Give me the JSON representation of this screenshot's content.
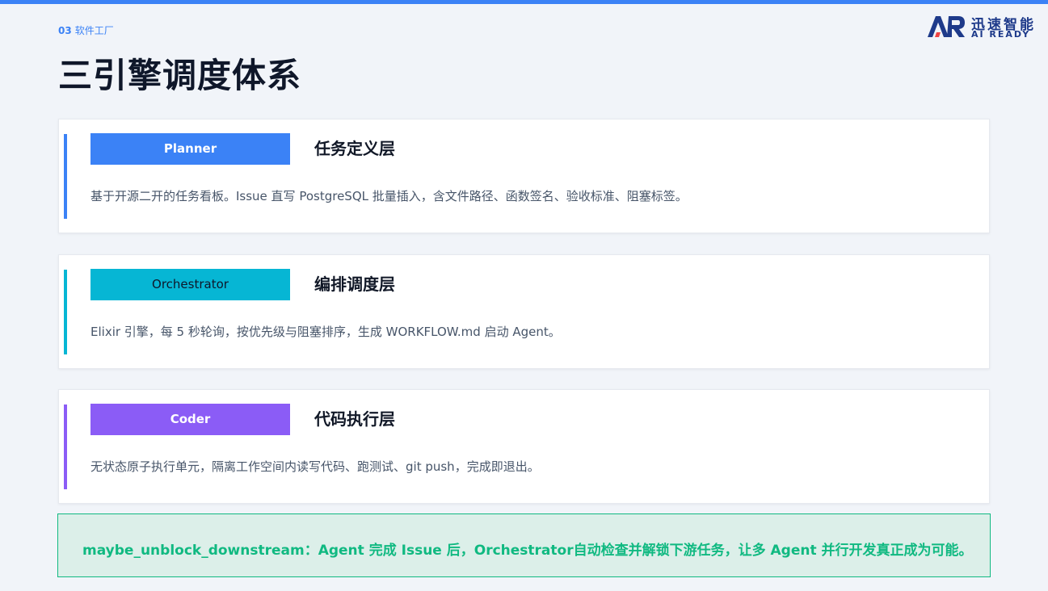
{
  "header": {
    "section_number": "03",
    "section_name": "软件工厂",
    "title": "三引擎调度体系"
  },
  "logo": {
    "name_cn": "迅速智能",
    "name_en": "AI READY",
    "icon": "air-logo-icon"
  },
  "colors": {
    "top_bar": "#3b82f6",
    "planner": "#3b82f6",
    "orchestrator": "#06b6d4",
    "coder": "#8b5cf6",
    "callout_text": "#10b981",
    "callout_bg": "#dcefe9"
  },
  "layers": [
    {
      "badge": "Planner",
      "title": "任务定义层",
      "desc": "基于开源二开的任务看板。Issue 直写 PostgreSQL 批量插入，含文件路径、函数签名、验收标准、阻塞标签。"
    },
    {
      "badge": "Orchestrator",
      "title": "编排调度层",
      "desc": "Elixir 引擎，每 5 秒轮询，按优先级与阻塞排序，生成 WORKFLOW.md 启动 Agent。"
    },
    {
      "badge": "Coder",
      "title": "代码执行层",
      "desc": "无状态原子执行单元，隔离工作空间内读写代码、跑测试、git push，完成即退出。"
    }
  ],
  "callout": {
    "text": "maybe_unblock_downstream：Agent 完成 Issue 后，Orchestrator自动检查并解锁下游任务，让多 Agent 并行开发真正成为可能。"
  }
}
